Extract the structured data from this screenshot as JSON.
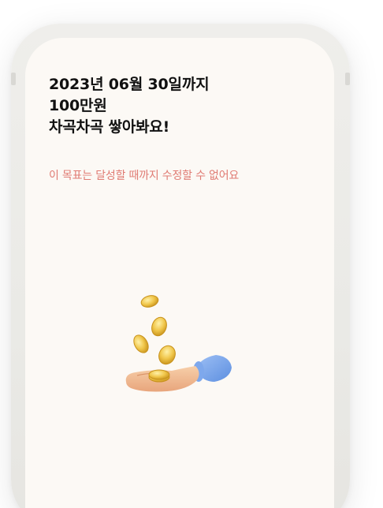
{
  "goal": {
    "date_line": "2023년 06월 30일까지",
    "amount_line": "100만원",
    "slogan_line": "차곡차곡 쌓아봐요!"
  },
  "notice": {
    "text": "이 목표는 달성할 때까지 수정할 수 없어요"
  },
  "illustration": {
    "icon": "hand-tossing-coins-icon"
  },
  "colors": {
    "screen_background": "#fcf9f5",
    "notice_text": "#e07b73",
    "headline_text": "#111111"
  }
}
